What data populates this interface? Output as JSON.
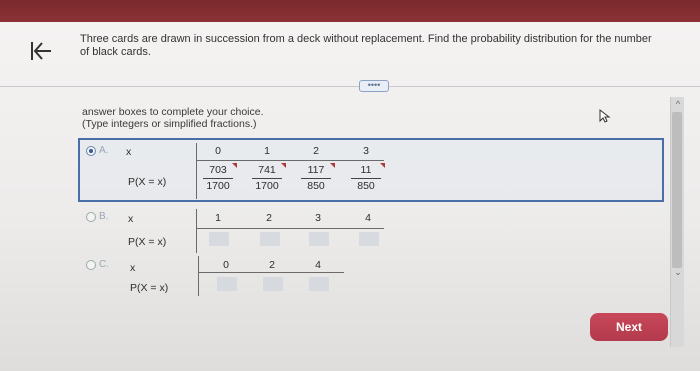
{
  "question": "Three cards are drawn in succession from a deck without replacement. Find the probability distribution for the number of black cards.",
  "more_button": "••••",
  "instructions": {
    "line1": "answer boxes to complete your choice.",
    "line2": "(Type integers or simplified fractions.)"
  },
  "option_a": {
    "letter": "A.",
    "x_label": "x",
    "px_label": "P(X = x)",
    "x_values": [
      "0",
      "1",
      "2",
      "3"
    ],
    "probabilities": [
      {
        "num": "703",
        "den": "1700"
      },
      {
        "num": "741",
        "den": "1700"
      },
      {
        "num": "117",
        "den": "850"
      },
      {
        "num": "11",
        "den": "850"
      }
    ]
  },
  "option_b": {
    "letter": "B.",
    "x_label": "x",
    "px_label": "P(X = x)",
    "x_values": [
      "1",
      "2",
      "3",
      "4"
    ]
  },
  "option_c": {
    "letter": "C.",
    "x_label": "x",
    "px_label": "P(X = x)",
    "x_values": [
      "0",
      "2",
      "4"
    ]
  },
  "next_button": "Next",
  "icons": {
    "back": "back-arrow-icon",
    "cursor": "pointer-cursor-icon",
    "scroll_up": "chevron-up-icon",
    "scroll_down": "chevron-down-icon"
  }
}
